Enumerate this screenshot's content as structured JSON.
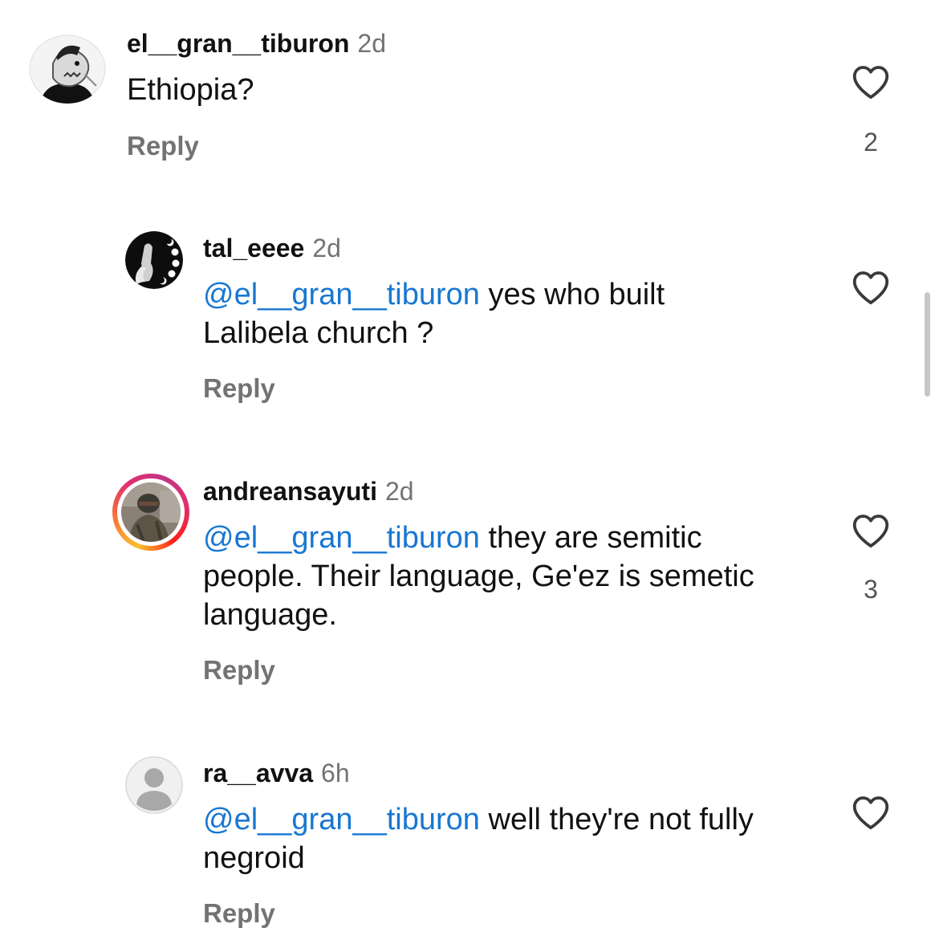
{
  "comments": [
    {
      "username": "el__gran__tiburon",
      "time": "2d",
      "mention": "",
      "text": "Ethiopia?",
      "reply_label": "Reply",
      "likes": "2",
      "avatar_icon": "shark-avatar-icon"
    },
    {
      "username": "tal_eeee",
      "time": "2d",
      "mention": "@el__gran__tiburon",
      "text": " yes who built Lalibela church ?",
      "reply_label": "Reply",
      "likes": "",
      "avatar_icon": "moon-phases-avatar-icon"
    },
    {
      "username": "andreansayuti",
      "time": "2d",
      "mention": "@el__gran__tiburon",
      "text": " they are semitic people. Their language, Ge'ez is semetic language.",
      "reply_label": "Reply",
      "likes": "3",
      "avatar_icon": "soldier-avatar-icon"
    },
    {
      "username": "ra__avva",
      "time": "6h",
      "mention": "@el__gran__tiburon",
      "text": " well they're not fully negroid",
      "reply_label": "Reply",
      "likes": "",
      "avatar_icon": "default-user-avatar-icon"
    }
  ],
  "colors": {
    "mention": "#1877d2",
    "secondary_text": "#737373",
    "primary_text": "#111111",
    "background": "#ffffff"
  }
}
